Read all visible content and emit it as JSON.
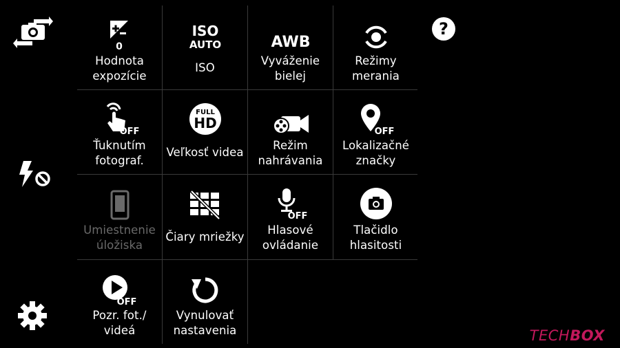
{
  "side": {
    "switch_camera_icon": "switch-camera-icon",
    "flash_icon": "flash-off-icon",
    "settings_icon": "gear-icon",
    "help_icon": "help-icon"
  },
  "grid": {
    "items": [
      {
        "label": "Hodnota\nexpozície",
        "icon_text": "0",
        "icon": "exposure-icon",
        "enabled": true
      },
      {
        "label": "ISO",
        "icon_text": "ISO",
        "icon_sub": "AUTO",
        "icon": "iso-auto-icon",
        "enabled": true
      },
      {
        "label": "Vyváženie\nbielej",
        "icon_text": "AWB",
        "icon": "awb-icon",
        "enabled": true
      },
      {
        "label": "Režimy\nmerania",
        "icon": "metering-icon",
        "enabled": true
      },
      {
        "label": "Ťuknutím\nfotograf.",
        "icon_text": "OFF",
        "icon": "tap-shot-off-icon",
        "enabled": true
      },
      {
        "label": "Veľkosť videa",
        "icon_text": "FULL",
        "icon_sub": "HD",
        "icon": "full-hd-icon",
        "enabled": true
      },
      {
        "label": "Režim\nnahrávania",
        "icon": "recording-mode-icon",
        "enabled": true
      },
      {
        "label": "Lokalizačné\nznačky",
        "icon_text": "OFF",
        "icon": "location-tag-off-icon",
        "enabled": true
      },
      {
        "label": "Umiestnenie\núložiska",
        "icon": "storage-icon",
        "enabled": false
      },
      {
        "label": "Čiary mriežky",
        "icon": "grid-lines-off-icon",
        "enabled": true
      },
      {
        "label": "Hlasové\novládanie",
        "icon_text": "OFF",
        "icon": "voice-control-off-icon",
        "enabled": true
      },
      {
        "label": "Tlačidlo\nhlasitosti",
        "icon": "volume-key-camera-icon",
        "enabled": true
      },
      {
        "label": "Pozr. fot./\nvideá",
        "icon_text": "OFF",
        "icon": "review-play-off-icon",
        "enabled": true
      },
      {
        "label": "Vynulovať\nnastavenia",
        "icon": "reset-icon",
        "enabled": true
      }
    ]
  },
  "logo": {
    "part1": "TECH",
    "part2": "BOX"
  }
}
